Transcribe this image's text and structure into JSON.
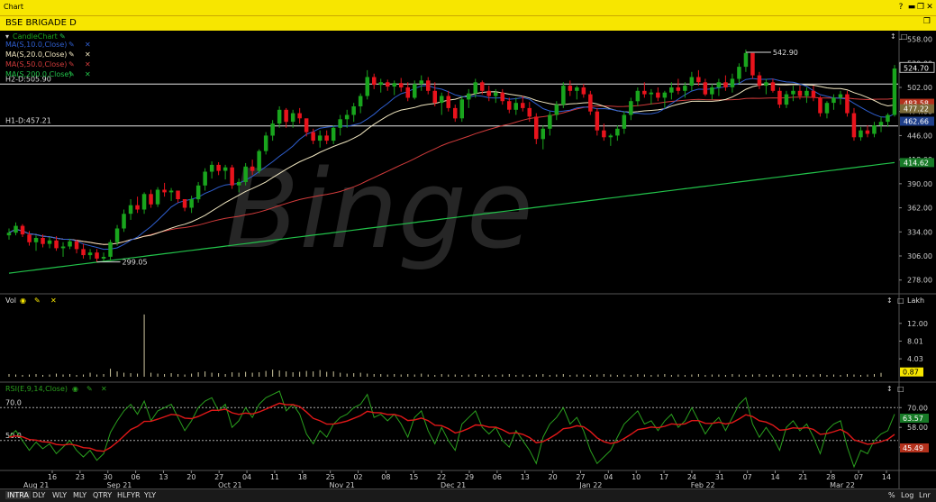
{
  "window": {
    "title": "Chart"
  },
  "chart_window": {
    "title": "BSE BRIGADE D"
  },
  "colors": {
    "bull": "#19a51d",
    "bear": "#e8131c",
    "ma10": "#2f5fd0",
    "ma20": "#f0e6c0",
    "ma50": "#d13b3b",
    "ma200": "#22c24a",
    "rsi": "#2aa01e",
    "rsi_ema": "#e01818",
    "vol": "#cfc8a0",
    "watermark": "#262626"
  },
  "price_panel": {
    "title": "CandleChart",
    "watermark": "Binge",
    "legend": [
      {
        "label": "MA(S,10.0,Close)",
        "color": "#2f5fd0"
      },
      {
        "label": "MA(S,20.0,Close)",
        "color": "#f0e6c0"
      },
      {
        "label": "MA(S,50.0,Close)",
        "color": "#d13b3b"
      },
      {
        "label": "MA(S,200.0,Close)",
        "color": "#22c24a"
      }
    ],
    "hlines": [
      {
        "label": "H2-D:505.90",
        "value": 505.9
      },
      {
        "label": "H1-D:457.21",
        "value": 457.21
      }
    ],
    "callouts": [
      {
        "label": "542.90",
        "value": 542.9
      },
      {
        "label": "299.05",
        "value": 299.05
      }
    ],
    "last_price": "524.70",
    "badges": [
      {
        "text": "483.58",
        "value": 483.58,
        "bg": "#b3311c"
      },
      {
        "text": "477.22",
        "value": 477.22,
        "bg": "#7a6a3a"
      },
      {
        "text": "462.66",
        "value": 462.66,
        "bg": "#1f3f8a"
      },
      {
        "text": "414.62",
        "value": 414.62,
        "bg": "#177a27"
      }
    ],
    "yticks": [
      "558.00",
      "530.00",
      "502.00",
      "474.00",
      "446.00",
      "418.00",
      "390.00",
      "362.00",
      "334.00",
      "306.00",
      "278.00"
    ]
  },
  "volume_panel": {
    "title": "Vol",
    "unit": "Lakh",
    "yticks": [
      "12.00",
      "8.01",
      "4.03"
    ],
    "last": "0.87"
  },
  "rsi_panel": {
    "title": "RSI(E,9,14,Close)",
    "levels": [
      "70.0",
      "50.0"
    ],
    "yticks": [
      "70.00",
      "58.00",
      "46.00"
    ],
    "badges": [
      "63.57",
      "45.49"
    ]
  },
  "x_axis": {
    "month_labels": [
      "Aug 21",
      "Sep 21",
      "Oct 21",
      "Nov 21",
      "Dec 21",
      "Jan 22",
      "Feb 22",
      "Mar 22"
    ],
    "day_labels": [
      "16",
      "23",
      "30",
      "06",
      "13",
      "20",
      "27",
      "04",
      "11",
      "18",
      "25",
      "02",
      "08",
      "15",
      "22",
      "29",
      "06",
      "13",
      "20",
      "27",
      "04",
      "10",
      "17",
      "24",
      "31",
      "07",
      "14",
      "21",
      "28",
      "07",
      "14"
    ]
  },
  "bottom_tabs": [
    "INTRA",
    "DLY",
    "WLY",
    "MLY",
    "QTRY",
    "HLFYR",
    "YLY"
  ],
  "bottom_right": [
    "%",
    "Log",
    "Lnr"
  ],
  "chart_data": {
    "type": "candlestick",
    "title": "BSE BRIGADE D",
    "ylim": [
      262,
      568
    ],
    "series": [
      {
        "name": "BRIGADE",
        "values": [
          [
            330,
            338,
            325,
            333
          ],
          [
            333,
            345,
            330,
            341
          ],
          [
            341,
            343,
            328,
            331
          ],
          [
            331,
            335,
            318,
            322
          ],
          [
            322,
            330,
            312,
            327
          ],
          [
            327,
            331,
            316,
            320
          ],
          [
            320,
            328,
            315,
            324
          ],
          [
            324,
            329,
            312,
            315
          ],
          [
            315,
            322,
            305,
            317
          ],
          [
            317,
            326,
            314,
            323
          ],
          [
            323,
            325,
            309,
            314
          ],
          [
            314,
            320,
            303,
            307
          ],
          [
            307,
            314,
            302,
            310
          ],
          [
            310,
            314,
            299,
            303
          ],
          [
            303,
            310,
            300,
            305
          ],
          [
            305,
            325,
            300,
            322
          ],
          [
            322,
            342,
            318,
            338
          ],
          [
            338,
            360,
            334,
            355
          ],
          [
            355,
            372,
            348,
            365
          ],
          [
            365,
            375,
            356,
            360
          ],
          [
            360,
            380,
            355,
            378
          ],
          [
            378,
            383,
            362,
            366
          ],
          [
            366,
            386,
            363,
            383
          ],
          [
            383,
            391,
            375,
            380
          ],
          [
            380,
            385,
            370,
            382
          ],
          [
            382,
            378,
            368,
            372
          ],
          [
            372,
            368,
            358,
            362
          ],
          [
            362,
            376,
            356,
            372
          ],
          [
            372,
            392,
            368,
            388
          ],
          [
            388,
            408,
            382,
            404
          ],
          [
            404,
            416,
            396,
            412
          ],
          [
            412,
            415,
            400,
            405
          ],
          [
            405,
            412,
            395,
            409
          ],
          [
            409,
            412,
            384,
            388
          ],
          [
            388,
            396,
            380,
            392
          ],
          [
            392,
            414,
            388,
            410
          ],
          [
            410,
            418,
            400,
            405
          ],
          [
            405,
            430,
            402,
            428
          ],
          [
            428,
            450,
            424,
            446
          ],
          [
            446,
            464,
            440,
            460
          ],
          [
            460,
            480,
            455,
            476
          ],
          [
            476,
            478,
            455,
            462
          ],
          [
            462,
            476,
            455,
            472
          ],
          [
            472,
            478,
            460,
            466
          ],
          [
            466,
            462,
            445,
            450
          ],
          [
            450,
            454,
            436,
            440
          ],
          [
            440,
            452,
            432,
            446
          ],
          [
            446,
            452,
            436,
            440
          ],
          [
            440,
            458,
            436,
            455
          ],
          [
            455,
            470,
            446,
            465
          ],
          [
            465,
            476,
            455,
            470
          ],
          [
            470,
            484,
            462,
            480
          ],
          [
            480,
            495,
            472,
            492
          ],
          [
            492,
            522,
            488,
            514
          ],
          [
            514,
            518,
            500,
            505
          ],
          [
            505,
            512,
            496,
            508
          ],
          [
            508,
            511,
            498,
            503
          ],
          [
            503,
            510,
            493,
            507
          ],
          [
            507,
            513,
            497,
            502
          ],
          [
            502,
            508,
            486,
            490
          ],
          [
            490,
            510,
            488,
            506
          ],
          [
            506,
            516,
            498,
            510
          ],
          [
            510,
            514,
            494,
            498
          ],
          [
            498,
            508,
            480,
            484
          ],
          [
            484,
            496,
            470,
            492
          ],
          [
            492,
            498,
            474,
            478
          ],
          [
            478,
            482,
            462,
            466
          ],
          [
            466,
            492,
            462,
            488
          ],
          [
            488,
            500,
            478,
            495
          ],
          [
            495,
            512,
            490,
            508
          ],
          [
            508,
            510,
            494,
            498
          ],
          [
            498,
            504,
            486,
            492
          ],
          [
            492,
            500,
            484,
            496
          ],
          [
            496,
            500,
            482,
            486
          ],
          [
            486,
            490,
            472,
            476
          ],
          [
            476,
            490,
            470,
            484
          ],
          [
            484,
            492,
            474,
            478
          ],
          [
            478,
            485,
            462,
            468
          ],
          [
            468,
            472,
            436,
            442
          ],
          [
            442,
            458,
            430,
            454
          ],
          [
            454,
            474,
            446,
            470
          ],
          [
            470,
            486,
            464,
            482
          ],
          [
            482,
            508,
            478,
            504
          ],
          [
            504,
            510,
            492,
            498
          ],
          [
            498,
            504,
            488,
            502
          ],
          [
            502,
            506,
            490,
            494
          ],
          [
            494,
            498,
            470,
            474
          ],
          [
            474,
            478,
            446,
            452
          ],
          [
            452,
            460,
            440,
            444
          ],
          [
            444,
            448,
            434,
            446
          ],
          [
            446,
            458,
            440,
            454
          ],
          [
            454,
            474,
            448,
            470
          ],
          [
            470,
            490,
            464,
            486
          ],
          [
            486,
            502,
            480,
            498
          ],
          [
            498,
            508,
            490,
            494
          ],
          [
            494,
            500,
            482,
            496
          ],
          [
            496,
            502,
            486,
            490
          ],
          [
            490,
            498,
            478,
            496
          ],
          [
            496,
            508,
            488,
            502
          ],
          [
            502,
            512,
            494,
            498
          ],
          [
            498,
            508,
            490,
            504
          ],
          [
            504,
            520,
            498,
            514
          ],
          [
            514,
            522,
            504,
            508
          ],
          [
            508,
            512,
            492,
            494
          ],
          [
            494,
            506,
            488,
            502
          ],
          [
            502,
            512,
            492,
            508
          ],
          [
            508,
            516,
            498,
            502
          ],
          [
            502,
            518,
            496,
            512
          ],
          [
            512,
            530,
            506,
            526
          ],
          [
            526,
            546,
            520,
            542
          ],
          [
            542,
            538,
            512,
            516
          ],
          [
            516,
            520,
            500,
            504
          ],
          [
            504,
            512,
            494,
            508
          ],
          [
            508,
            512,
            496,
            498
          ],
          [
            498,
            502,
            478,
            482
          ],
          [
            482,
            498,
            478,
            494
          ],
          [
            494,
            504,
            486,
            498
          ],
          [
            498,
            504,
            488,
            492
          ],
          [
            492,
            502,
            484,
            498
          ],
          [
            498,
            504,
            486,
            490
          ],
          [
            490,
            492,
            468,
            472
          ],
          [
            472,
            486,
            466,
            484
          ],
          [
            484,
            494,
            476,
            490
          ],
          [
            490,
            498,
            482,
            494
          ],
          [
            494,
            498,
            468,
            472
          ],
          [
            472,
            478,
            440,
            444
          ],
          [
            444,
            456,
            440,
            452
          ],
          [
            452,
            458,
            444,
            448
          ],
          [
            448,
            462,
            444,
            458
          ],
          [
            458,
            468,
            450,
            462
          ],
          [
            462,
            472,
            456,
            470
          ],
          [
            470,
            528,
            468,
            524
          ]
        ]
      }
    ],
    "volume": [
      0.6,
      0.5,
      0.4,
      0.5,
      0.6,
      0.4,
      0.5,
      0.7,
      0.5,
      0.6,
      0.4,
      0.5,
      0.9,
      0.5,
      0.6,
      1.8,
      1.2,
      0.9,
      0.8,
      0.7,
      14.0,
      0.9,
      0.7,
      0.6,
      0.8,
      0.6,
      0.5,
      0.7,
      1.0,
      1.2,
      0.9,
      0.8,
      0.6,
      1.0,
      0.9,
      1.1,
      0.9,
      1.0,
      1.3,
      1.6,
      1.4,
      1.2,
      1.0,
      1.1,
      1.3,
      1.2,
      1.5,
      1.1,
      1.2,
      0.9,
      0.7,
      0.8,
      0.9,
      0.7,
      0.6,
      0.6,
      0.5,
      0.6,
      0.5,
      0.6,
      0.5,
      0.7,
      0.5,
      0.4,
      0.6,
      0.5,
      0.5,
      0.4,
      0.5,
      0.6,
      0.4,
      0.5,
      0.4,
      0.5,
      0.6,
      0.4,
      0.5,
      0.4,
      0.5,
      0.6,
      0.4,
      0.5,
      0.6,
      0.4,
      0.5,
      0.5,
      0.4,
      0.5,
      0.6,
      0.5,
      0.4,
      0.5,
      0.4,
      0.6,
      0.5,
      0.4,
      0.5,
      0.6,
      0.4,
      0.5,
      0.4,
      0.5,
      0.6,
      0.4,
      0.5,
      0.5,
      0.4,
      0.6,
      0.5,
      0.4,
      0.5,
      0.6,
      0.4,
      0.5,
      0.4,
      0.5,
      0.6,
      0.5,
      0.4,
      0.5,
      0.6,
      0.4,
      0.5,
      0.4,
      0.6,
      0.5,
      0.4,
      0.5,
      0.6,
      0.87
    ],
    "rsi": [
      52,
      56,
      50,
      44,
      49,
      45,
      48,
      42,
      46,
      50,
      44,
      40,
      44,
      38,
      42,
      55,
      62,
      68,
      72,
      66,
      74,
      62,
      68,
      70,
      72,
      64,
      56,
      62,
      70,
      74,
      76,
      68,
      72,
      58,
      62,
      70,
      64,
      72,
      76,
      78,
      80,
      68,
      72,
      66,
      54,
      48,
      56,
      52,
      60,
      64,
      66,
      70,
      72,
      78,
      64,
      66,
      62,
      66,
      60,
      52,
      64,
      68,
      56,
      48,
      58,
      50,
      44,
      60,
      64,
      68,
      58,
      54,
      58,
      50,
      46,
      56,
      50,
      44,
      36,
      52,
      60,
      64,
      70,
      60,
      64,
      56,
      44,
      36,
      40,
      44,
      52,
      60,
      64,
      68,
      60,
      62,
      56,
      62,
      66,
      58,
      62,
      70,
      62,
      54,
      60,
      64,
      56,
      64,
      72,
      76,
      60,
      52,
      58,
      52,
      44,
      58,
      62,
      56,
      60,
      52,
      42,
      56,
      60,
      62,
      46,
      34,
      44,
      42,
      50,
      54,
      56,
      66
    ]
  }
}
